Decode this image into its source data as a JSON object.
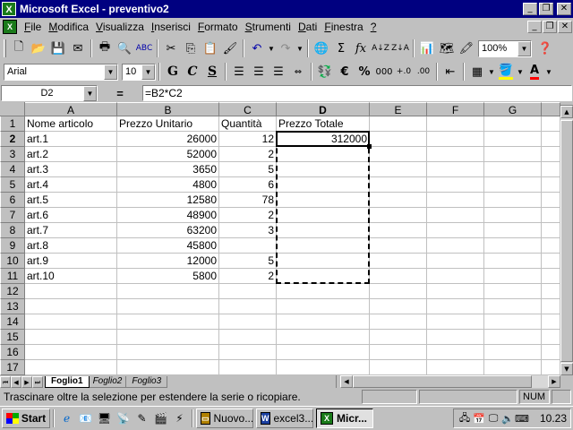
{
  "window": {
    "title": "Microsoft Excel - preventivo2",
    "app_icon": "X",
    "controls": [
      "minimize-icon",
      "restore-icon",
      "close-icon"
    ]
  },
  "menu": {
    "items": [
      "File",
      "Modifica",
      "Visualizza",
      "Inserisci",
      "Formato",
      "Strumenti",
      "Dati",
      "Finestra",
      "?"
    ]
  },
  "toolbar_standard": {
    "zoom": "100%"
  },
  "toolbar_format": {
    "font": "Arial",
    "size": "10",
    "bold": "G",
    "italic": "C",
    "underline": "S",
    "currency": "€",
    "percent": "%",
    "thousands": "000",
    "font_color": "#ff0000",
    "fill_color": "#ffff00"
  },
  "formula_bar": {
    "cell_ref": "D2",
    "equals": "=",
    "formula": "=B2*C2"
  },
  "sheet": {
    "columns": [
      "A",
      "B",
      "C",
      "D",
      "E",
      "F",
      "G"
    ],
    "active_column": "D",
    "active_row": 2,
    "rows": [
      {
        "n": 1,
        "A": "Nome articolo",
        "B": "Prezzo Unitario",
        "C": "Quantità",
        "D": "Prezzo Totale"
      },
      {
        "n": 2,
        "A": "art.1",
        "B": "26000",
        "C": "12",
        "D": "312000"
      },
      {
        "n": 3,
        "A": "art.2",
        "B": "52000",
        "C": "2",
        "D": ""
      },
      {
        "n": 4,
        "A": "art.3",
        "B": "3650",
        "C": "5",
        "D": ""
      },
      {
        "n": 5,
        "A": "art.4",
        "B": "4800",
        "C": "6",
        "D": ""
      },
      {
        "n": 6,
        "A": "art.5",
        "B": "12580",
        "C": "78",
        "D": ""
      },
      {
        "n": 7,
        "A": "art.6",
        "B": "48900",
        "C": "2",
        "D": ""
      },
      {
        "n": 8,
        "A": "art.7",
        "B": "63200",
        "C": "3",
        "D": ""
      },
      {
        "n": 9,
        "A": "art.8",
        "B": "45800",
        "C": "",
        "D": ""
      },
      {
        "n": 10,
        "A": "art.9",
        "B": "12000",
        "C": "5",
        "D": ""
      },
      {
        "n": 11,
        "A": "art.10",
        "B": "5800",
        "C": "2",
        "D": ""
      },
      {
        "n": 12,
        "A": "",
        "B": "",
        "C": "",
        "D": ""
      },
      {
        "n": 13,
        "A": "",
        "B": "",
        "C": "",
        "D": ""
      },
      {
        "n": 14,
        "A": "",
        "B": "",
        "C": "",
        "D": ""
      },
      {
        "n": 15,
        "A": "",
        "B": "",
        "C": "",
        "D": ""
      },
      {
        "n": 16,
        "A": "",
        "B": "",
        "C": "",
        "D": ""
      },
      {
        "n": 17,
        "A": "",
        "B": "",
        "C": "",
        "D": ""
      }
    ],
    "selection": {
      "from": "D2",
      "to": "D11"
    }
  },
  "tabs": {
    "items": [
      "Foglio1",
      "Foglio2",
      "Foglio3"
    ],
    "active": "Foglio1"
  },
  "status": {
    "message": "Trascinare oltre la selezione per estendere la serie o ricopiare.",
    "num": "NUM"
  },
  "taskbar": {
    "start": "Start",
    "tasks": [
      {
        "label": "Nuovo...",
        "icon": "folder-icon",
        "active": false
      },
      {
        "label": "excel3...",
        "icon": "word-icon",
        "active": false
      },
      {
        "label": "Micr...",
        "icon": "excel-icon",
        "active": true
      }
    ],
    "clock": "10.23"
  }
}
